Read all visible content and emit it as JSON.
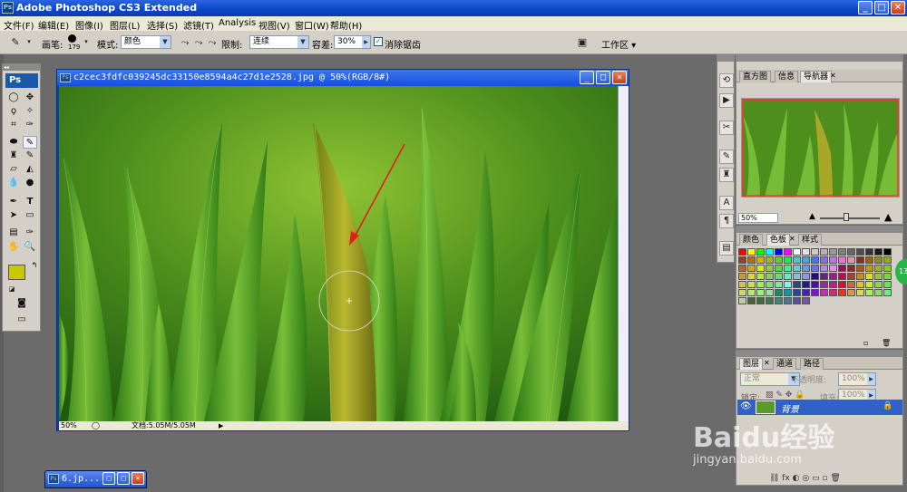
{
  "app": {
    "title": "Adobe Photoshop CS3 Extended",
    "ps_logo": "Ps",
    "window_buttons": [
      "_",
      "□",
      "✕"
    ]
  },
  "menu": [
    "文件(F)",
    "编辑(E)",
    "图像(I)",
    "图层(L)",
    "选择(S)",
    "滤镜(T)",
    "Analysis",
    "视图(V)",
    "窗口(W)",
    "帮助(H)"
  ],
  "options_bar": {
    "brush_label": "画笔:",
    "brush_size": "179",
    "mode_label": "模式:",
    "mode_value": "颜色",
    "limits_label": "限制:",
    "limits_value": "连续",
    "tolerance_label": "容差:",
    "tolerance_value": "30%",
    "antialias_label": "消除锯齿",
    "antialias_checked": true,
    "workspace_label": "工作区 ▾"
  },
  "toolbox": {
    "collapse": "◂◂",
    "foreground_color": "#c8c800",
    "background_color": "#000000"
  },
  "document": {
    "title": "c2cec3fdfc039245dc33150e8594a4c27d1e2528.jpg @ 50%(RGB/8#)",
    "zoom": "50%",
    "doc_info": "文档:5.05M/5.05M"
  },
  "minimized_doc": {
    "title": "6.jp..."
  },
  "navigator_panel": {
    "tabs": [
      "直方图",
      "信息",
      "导航器"
    ],
    "active_tab": "导航器",
    "zoom": "50%"
  },
  "swatches_panel": {
    "tabs": [
      "颜色",
      "色板",
      "样式"
    ],
    "active_tab": "色板"
  },
  "layers_panel": {
    "tabs": [
      "图层",
      "通道",
      "路径"
    ],
    "active_tab": "图层",
    "blend_mode": "正常",
    "opacity_label": "不透明度:",
    "opacity_value": "100%",
    "lock_label": "锁定:",
    "fill_label": "填充:",
    "fill_value": "100%",
    "layer_name": "背景"
  },
  "side_badge": "13",
  "watermark": {
    "brand": "Baidu经验",
    "url": "jingyan.baidu.com"
  },
  "colors": {
    "titlebar": "#0a46c8",
    "workspace": "#6b6b6b",
    "selected_layer": "#3161c6",
    "grass": "#3f8a1c"
  }
}
